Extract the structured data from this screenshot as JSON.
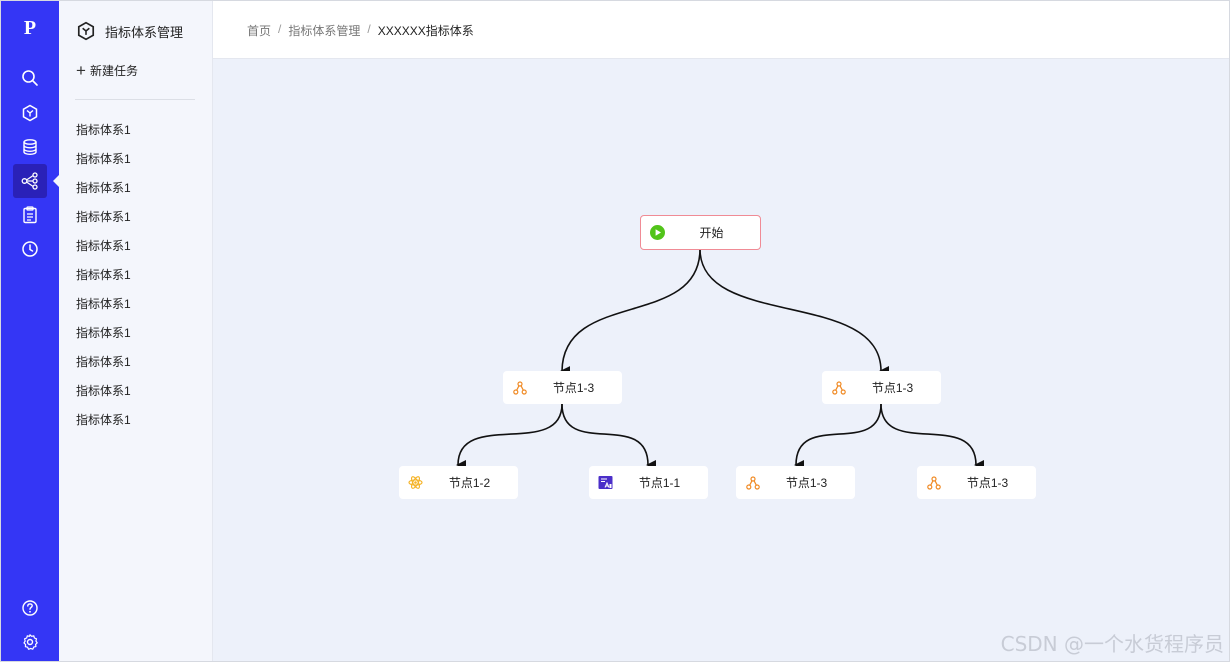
{
  "rail": {
    "logo": "P",
    "active_item": "flow"
  },
  "sidebar": {
    "title": "指标体系管理",
    "new_task_label": "新建任务",
    "items": [
      {
        "label": "指标体系1"
      },
      {
        "label": "指标体系1"
      },
      {
        "label": "指标体系1"
      },
      {
        "label": "指标体系1"
      },
      {
        "label": "指标体系1"
      },
      {
        "label": "指标体系1"
      },
      {
        "label": "指标体系1"
      },
      {
        "label": "指标体系1"
      },
      {
        "label": "指标体系1"
      },
      {
        "label": "指标体系1"
      },
      {
        "label": "指标体系1"
      }
    ]
  },
  "breadcrumb": {
    "items": [
      "首页",
      "指标体系管理",
      "XXXXXX指标体系"
    ],
    "separator": "/"
  },
  "flow": {
    "start": {
      "label": "开始",
      "icon": "play-circle-icon"
    },
    "level1": [
      {
        "label": "节点1-3",
        "icon": "tree-structure-icon"
      },
      {
        "label": "节点1-3",
        "icon": "tree-structure-icon"
      }
    ],
    "level2": [
      {
        "label": "节点1-2",
        "icon": "atom-icon"
      },
      {
        "label": "节点1-1",
        "icon": "table-chart-icon"
      },
      {
        "label": "节点1-3",
        "icon": "tree-structure-icon"
      },
      {
        "label": "节点1-3",
        "icon": "tree-structure-icon"
      }
    ]
  },
  "colors": {
    "rail": "#3436f5",
    "rail_active": "#2a21b8",
    "canvas": "#edf1fa",
    "start_border": "#f08b95",
    "start_icon": "#52c41a",
    "node_icon": "#f08a24"
  },
  "watermark": "CSDN @一个水货程序员"
}
